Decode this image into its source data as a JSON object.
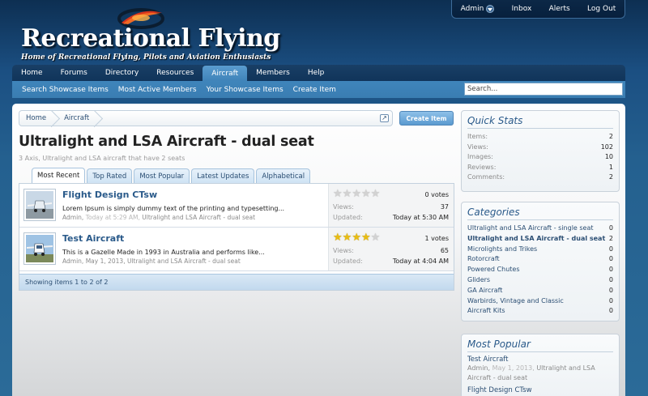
{
  "user_bar": {
    "account": "Admin",
    "inbox": "Inbox",
    "alerts": "Alerts",
    "logout": "Log Out"
  },
  "logo": {
    "title": "Recreational Flying",
    "tagline": "Home of Recreational Flying, Pilots and Aviation Enthusiasts"
  },
  "nav": {
    "tabs": [
      "Home",
      "Forums",
      "Directory",
      "Resources",
      "Aircraft",
      "Members",
      "Help"
    ],
    "active": "Aircraft"
  },
  "subnav": {
    "links": [
      "Search Showcase Items",
      "Most Active Members",
      "Your Showcase Items",
      "Create Item"
    ],
    "search_placeholder": "Search..."
  },
  "breadcrumb": [
    "Home",
    "Aircraft"
  ],
  "create_button": "Create Item",
  "page": {
    "title": "Ultralight and LSA Aircraft - dual seat",
    "description": "3 Axis, Ultralight and LSA aircraft that have 2 seats"
  },
  "sort_tabs": [
    "Most Recent",
    "Top Rated",
    "Most Popular",
    "Latest Updates",
    "Alphabetical"
  ],
  "active_sort_tab": "Most Recent",
  "items": [
    {
      "title": "Flight Design CTsw",
      "snippet": "Lorem Ipsum is simply dummy text of the printing and typesetting...",
      "author": "Admin,",
      "date": "Today at 5:29 AM,",
      "category": "Ultralight and LSA Aircraft - dual seat",
      "rating": 0,
      "votes": "0 votes",
      "views_label": "Views:",
      "views": "37",
      "updated_label": "Updated:",
      "updated": "Today at 5:30 AM"
    },
    {
      "title": "Test Aircraft",
      "snippet": "This is a Gazelle Made in 1993 in Australia and performs like...",
      "author": "Admin,",
      "date": "May 1, 2013,",
      "category": "Ultralight and LSA Aircraft - dual seat",
      "rating": 4,
      "votes": "1 votes",
      "views_label": "Views:",
      "views": "65",
      "updated_label": "Updated:",
      "updated": "Today at 4:04 AM"
    }
  ],
  "list_footer": "Showing items 1 to 2 of 2",
  "quick_stats": {
    "title": "Quick Stats",
    "rows": [
      {
        "label": "Items:",
        "value": "2"
      },
      {
        "label": "Views:",
        "value": "102"
      },
      {
        "label": "Images:",
        "value": "10"
      },
      {
        "label": "Reviews:",
        "value": "1"
      },
      {
        "label": "Comments:",
        "value": "2"
      }
    ]
  },
  "categories": {
    "title": "Categories",
    "rows": [
      {
        "label": "Ultralight and LSA Aircraft - single seat",
        "value": "0"
      },
      {
        "label": "Ultralight and LSA Aircraft - dual seat",
        "value": "2"
      },
      {
        "label": "Microlights and Trikes",
        "value": "0"
      },
      {
        "label": "Rotorcraft",
        "value": "0"
      },
      {
        "label": "Powered Chutes",
        "value": "0"
      },
      {
        "label": "Gliders",
        "value": "0"
      },
      {
        "label": "GA Aircraft",
        "value": "0"
      },
      {
        "label": "Warbirds, Vintage and Classic",
        "value": "0"
      },
      {
        "label": "Aircraft Kits",
        "value": "0"
      }
    ],
    "selected": "Ultralight and LSA Aircraft - dual seat"
  },
  "most_popular": {
    "title": "Most Popular",
    "items": [
      {
        "title": "Test Aircraft",
        "author": "Admin,",
        "date": "May 1, 2013,",
        "category": "Ultralight and LSA Aircraft - dual seat"
      },
      {
        "title": "Flight Design CTsw"
      }
    ]
  },
  "colors": {
    "accent": "#3f83b9",
    "link": "#2a5a8a",
    "nav_dark": "#10345a",
    "star": "#e9bd12"
  }
}
